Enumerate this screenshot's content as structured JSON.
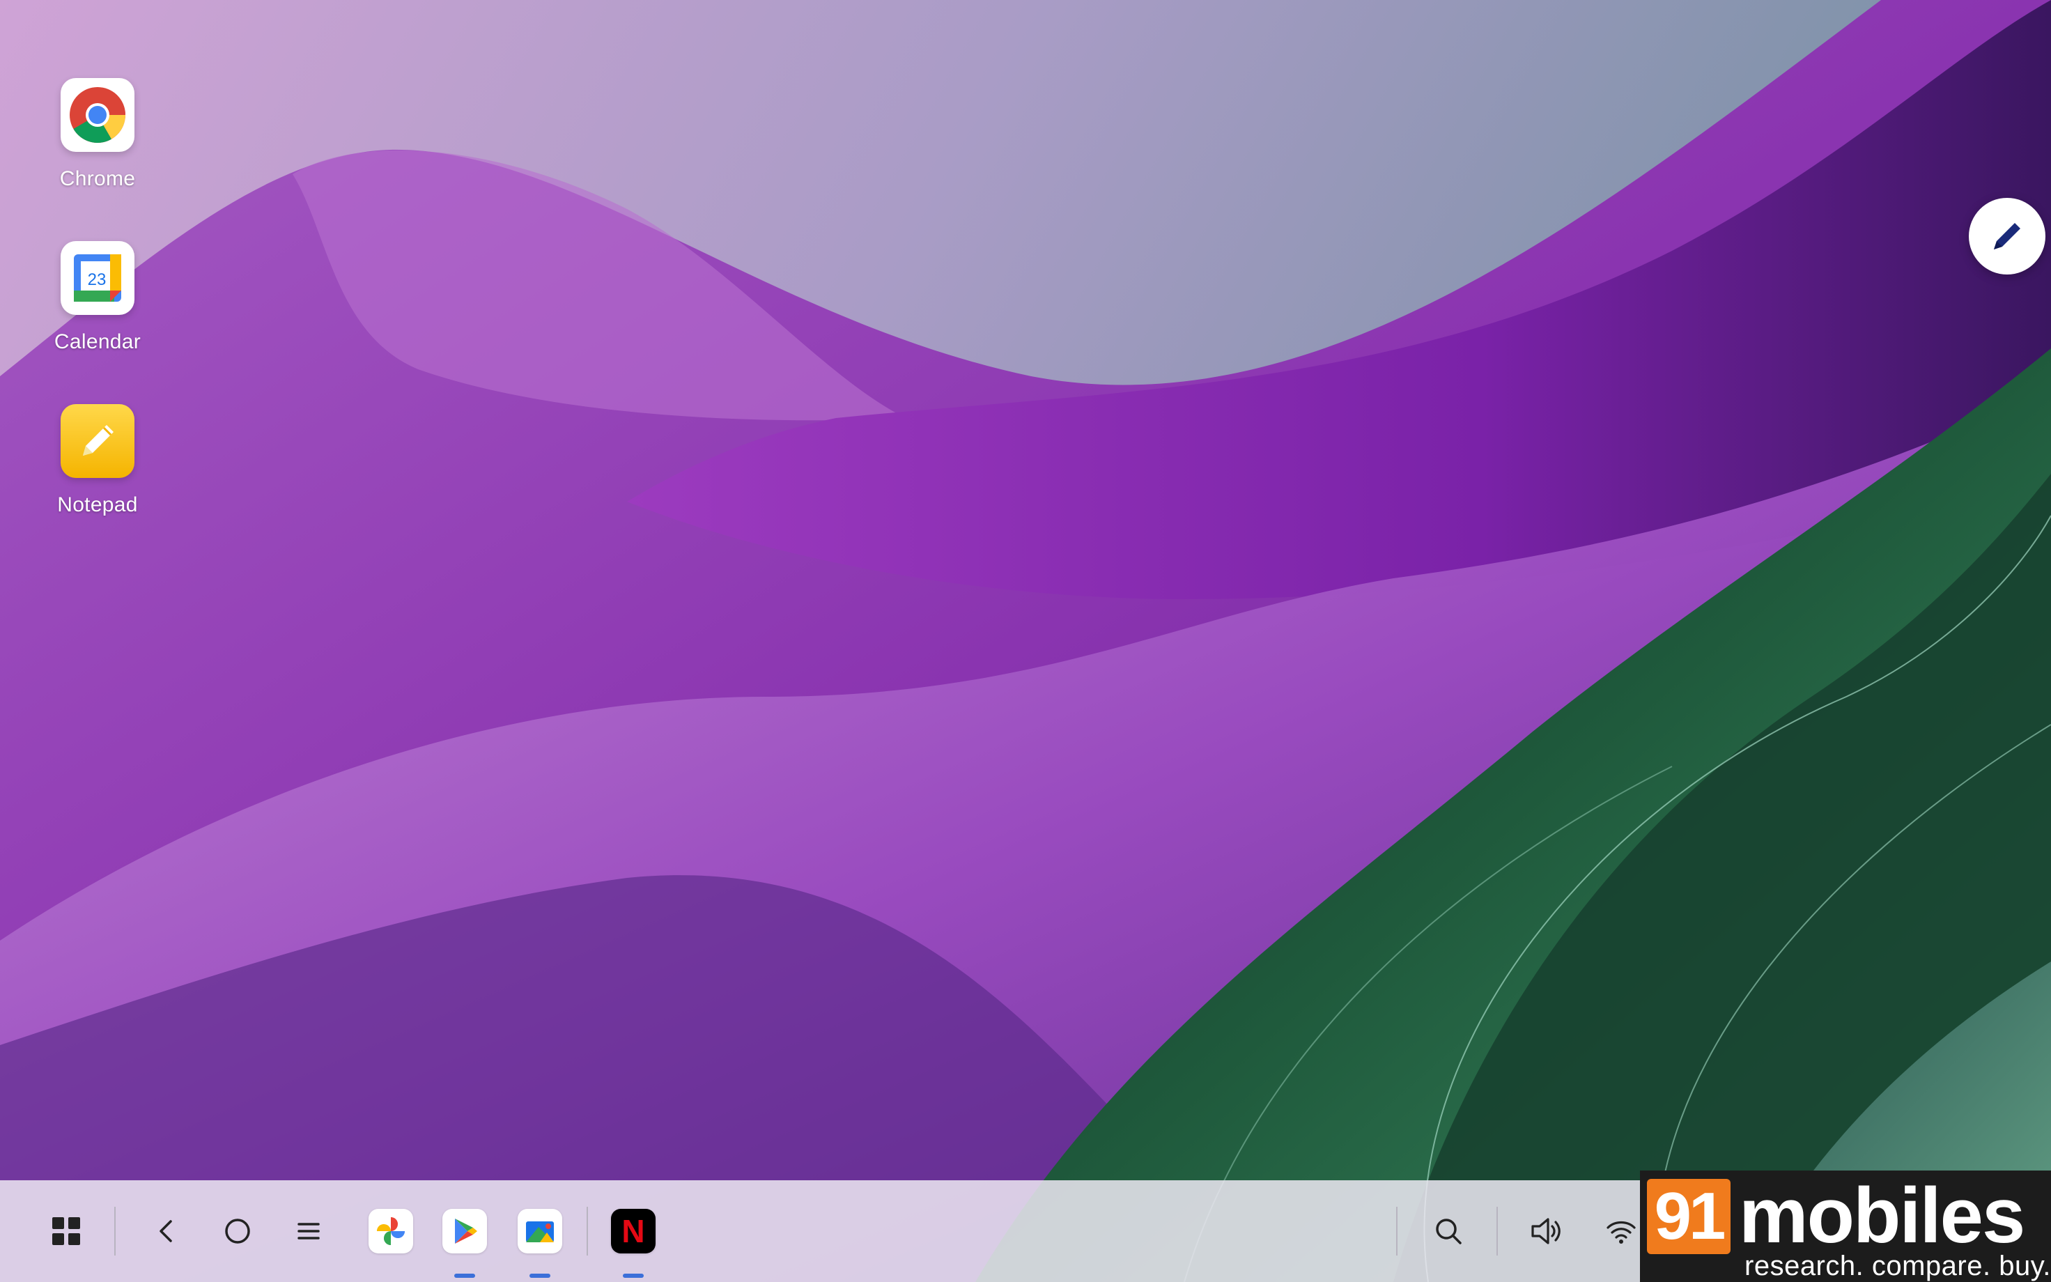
{
  "desktop": {
    "icons": [
      {
        "label": "Chrome",
        "icon": "chrome-icon"
      },
      {
        "label": "Calendar",
        "icon": "calendar-icon",
        "date": "23"
      },
      {
        "label": "Notepad",
        "icon": "notepad-icon"
      }
    ]
  },
  "floating": {
    "icon": "pen-icon"
  },
  "taskbar": {
    "left_buttons": [
      "apps-grid-icon",
      "back-icon",
      "home-icon",
      "recents-icon"
    ],
    "pinned_apps": [
      "photos-icon",
      "play-store-icon",
      "files-icon",
      "netflix-icon"
    ],
    "netflix_letter": "N",
    "right_buttons": [
      "search-icon",
      "volume-icon",
      "wifi-icon"
    ]
  },
  "watermark": {
    "badge": "91",
    "brand": "mobiles",
    "tagline": "research. compare. buy."
  },
  "colors": {
    "running_indicator": "#3b6fd9",
    "netflix_red": "#e50914",
    "watermark_orange": "#f07b1d"
  }
}
